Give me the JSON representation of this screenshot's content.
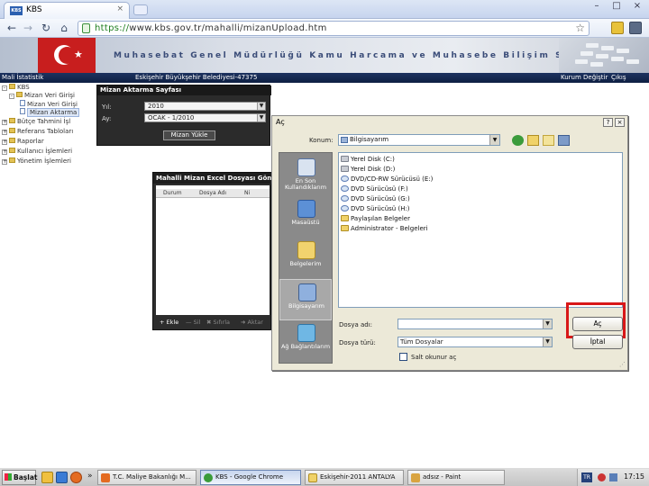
{
  "browser": {
    "tab_title": "KBS",
    "tab_favicon_text": "KBS",
    "tab_close": "×",
    "window_controls": [
      "–",
      "□",
      "×"
    ],
    "url_scheme": "https://",
    "url_rest": "www.kbs.gov.tr/mahalli/mizanUpload.htm",
    "star": "☆",
    "nav": {
      "back": "←",
      "forward": "→",
      "reload": "↻",
      "home": "⌂"
    }
  },
  "header": {
    "title": "Muhasebat Genel Müdürlüğü Kamu Harcama ve Muhasebe Bilişim Sistemi",
    "flag_star": "★"
  },
  "menubar": {
    "left": "Mali İstatistik",
    "org": "Eskişehir Büyükşehir Belediyesi-47375",
    "right1": "Kurum Değiştir",
    "right2": "Çıkış"
  },
  "tree": {
    "items": [
      {
        "label": "KBS"
      },
      {
        "label": "Mizan Veri Girişi"
      },
      {
        "label": "Mizan Veri Girişi"
      },
      {
        "label": "Mizan Aktarma"
      },
      {
        "label": "Bütçe Tahmini İşl"
      },
      {
        "label": "Referans Tabloları"
      },
      {
        "label": "Raporlar"
      },
      {
        "label": "Kullanıcı İşlemleri"
      },
      {
        "label": "Yönetim İşlemleri"
      }
    ]
  },
  "mizan_aktarma": {
    "title": "Mizan Aktarma Sayfası",
    "yil_label": "Yıl:",
    "yil_value": "2010",
    "ay_label": "Ay:",
    "ay_value": "OCAK - 1/2010",
    "button": "Mizan Yükle"
  },
  "upload_panel": {
    "title": "Mahalli Mizan Excel Dosyası Gönderim",
    "columns": [
      "Durum",
      "Dosya Adı",
      "Ni"
    ],
    "footer": [
      "+ Ekle",
      "— Sil",
      "✖ Sıfırla",
      "➜ Aktar"
    ]
  },
  "dialog": {
    "title": "Aç",
    "help": "?",
    "close": "×",
    "konum_label": "Konum:",
    "konum_value": "Bilgisayarım",
    "places": [
      {
        "label": "En Son Kullandıklarım"
      },
      {
        "label": "Masaüstü"
      },
      {
        "label": "Belgelerim"
      },
      {
        "label": "Bilgisayarım"
      },
      {
        "label": "Ağ Bağlantılarım"
      }
    ],
    "files": [
      {
        "name": "Yerel Disk (C:)",
        "kind": "drv"
      },
      {
        "name": "Yerel Disk (D:)",
        "kind": "drv"
      },
      {
        "name": "DVD/CD-RW Sürücüsü (E:)",
        "kind": "cd"
      },
      {
        "name": "DVD Sürücüsü (F:)",
        "kind": "cd"
      },
      {
        "name": "DVD Sürücüsü (G:)",
        "kind": "cd"
      },
      {
        "name": "DVD Sürücüsü (H:)",
        "kind": "cd"
      },
      {
        "name": "Paylaşılan Belgeler",
        "kind": "fold"
      },
      {
        "name": "Administrator - Belgeleri",
        "kind": "fold"
      }
    ],
    "dosya_adi_label": "Dosya adı:",
    "dosya_adi_value": "",
    "dosya_turu_label": "Dosya türü:",
    "dosya_turu_value": "Tüm Dosyalar",
    "readonly_label": "Salt okunur aç",
    "open_button": "Aç",
    "cancel_button": "İptal"
  },
  "taskbar": {
    "start": "Başlat",
    "arrows": "»",
    "tasks": [
      {
        "label": "T.C. Maliye Bakanlığı M..."
      },
      {
        "label": "KBS - Google Chrome"
      },
      {
        "label": "Eskişehir-2011 ANTALYA"
      },
      {
        "label": "adsız - Paint"
      }
    ],
    "lang": "TR",
    "clock": "17:15"
  }
}
